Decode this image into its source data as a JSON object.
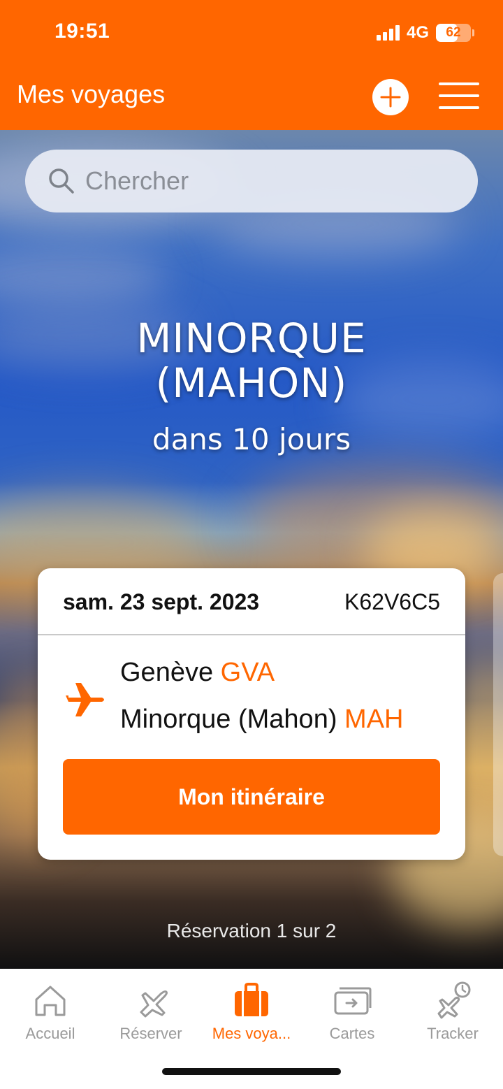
{
  "status_bar": {
    "time": "19:51",
    "network": "4G",
    "battery": "62",
    "battery_level": 0.62
  },
  "header": {
    "title": "Mes voyages",
    "add_icon": "plus-circle-icon",
    "menu_icon": "hamburger-menu-icon"
  },
  "search": {
    "placeholder": "Chercher",
    "icon": "search-icon"
  },
  "destination": {
    "line1": "MINORQUE",
    "line2": "(MAHON)",
    "countdown": "dans 10 jours"
  },
  "booking": {
    "date": "sam. 23 sept. 2023",
    "reference": "K62V6C5",
    "origin_city": "Genève",
    "origin_code": "GVA",
    "dest_city": "Minorque (Mahon)",
    "dest_code": "MAH",
    "button_label": "Mon itinéraire"
  },
  "pagination": "Réservation 1 sur 2",
  "tabs": [
    {
      "label": "Accueil",
      "icon": "home-icon",
      "active": false
    },
    {
      "label": "Réserver",
      "icon": "airplane-icon",
      "active": false
    },
    {
      "label": "Mes voya...",
      "icon": "suitcase-icon",
      "active": true
    },
    {
      "label": "Cartes",
      "icon": "boarding-pass-icon",
      "active": false
    },
    {
      "label": "Tracker",
      "icon": "flight-tracker-icon",
      "active": false
    }
  ],
  "colors": {
    "brand": "#ff6600",
    "tab_inactive": "#9a9a9a",
    "card_bg": "#ffffff"
  }
}
